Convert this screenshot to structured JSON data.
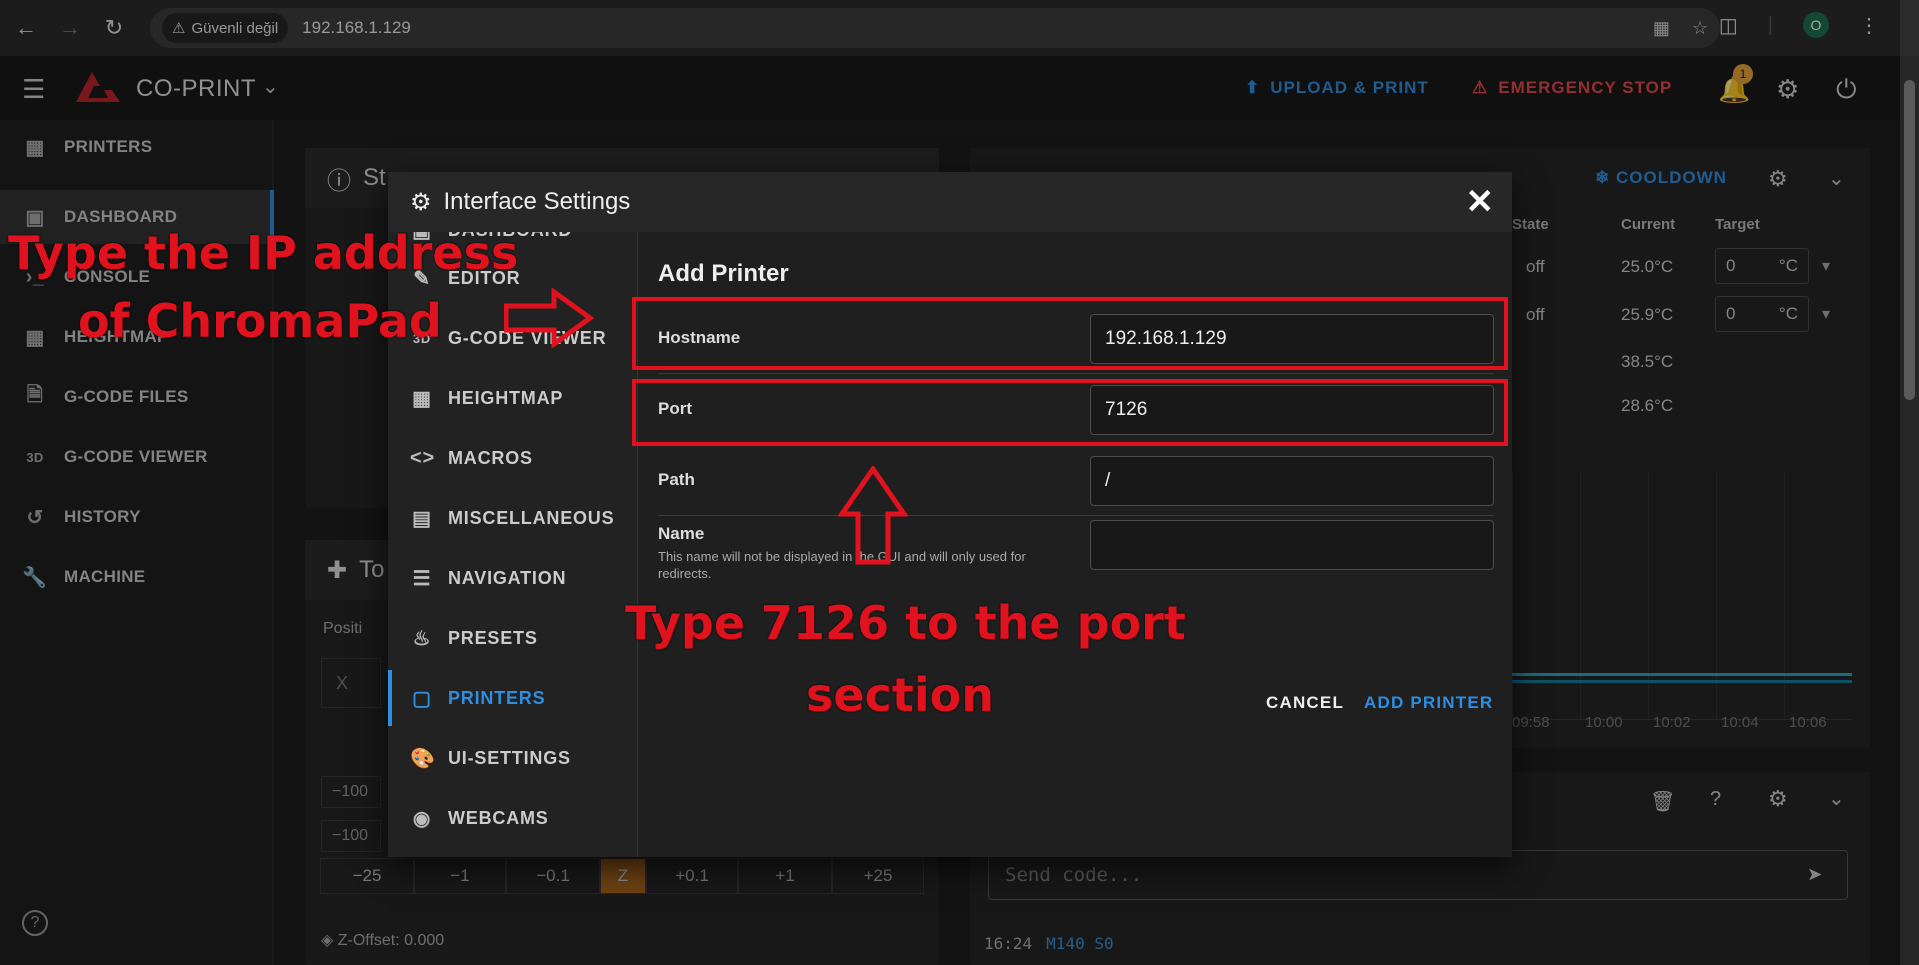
{
  "browser": {
    "security_label": "Güvenli değil",
    "url": "192.168.1.129",
    "profile_initial": "O"
  },
  "app": {
    "brand": "CO-PRINT",
    "upload_label": "UPLOAD & PRINT",
    "estop_label": "EMERGENCY STOP",
    "notification_count": "1",
    "accent_color": "#2e8ee0",
    "danger_color": "#e5484d"
  },
  "sidebar": {
    "items": [
      {
        "label": "PRINTERS",
        "icon": "grid-icon"
      },
      {
        "label": "DASHBOARD",
        "icon": "monitor-icon"
      },
      {
        "label": "CONSOLE",
        "icon": "console-icon"
      },
      {
        "label": "HEIGHTMAP",
        "icon": "heightmap-icon"
      },
      {
        "label": "G-CODE FILES",
        "icon": "file-icon"
      },
      {
        "label": "G-CODE VIEWER",
        "icon": "3d-icon"
      },
      {
        "label": "HISTORY",
        "icon": "history-icon"
      },
      {
        "label": "MACHINE",
        "icon": "wrench-icon"
      }
    ]
  },
  "background": {
    "status_title": "St",
    "toolhead_title": "To",
    "position_label": "Positi",
    "x_label": "X",
    "jog_values": [
      "−25",
      "−1",
      "−0.1",
      "Z",
      "+0.1",
      "+1",
      "+25"
    ],
    "minus100a": "−100",
    "minus100b": "−100",
    "zoffset": "Z-Offset: 0.000",
    "cooldown": "COOLDOWN",
    "temp_headers": {
      "state": "State",
      "current": "Current",
      "target": "Target"
    },
    "temp_rows": [
      {
        "state": "off",
        "current": "25.0°C",
        "target": "0",
        "unit": "°C"
      },
      {
        "state": "off",
        "current": "25.9°C",
        "target": "0",
        "unit": "°C"
      },
      {
        "state": "",
        "current": "38.5°C"
      },
      {
        "state": "",
        "current": "28.6°C"
      }
    ],
    "chart_ticks": [
      "09:58",
      "10:00",
      "10:02",
      "10:04",
      "10:06"
    ],
    "send_placeholder": "Send code...",
    "console_time": "16:24",
    "console_cmd": "M140 S0"
  },
  "modal": {
    "title": "Interface Settings",
    "nav": [
      {
        "label": "DASHBOARD",
        "icon": "monitor-icon"
      },
      {
        "label": "EDITOR",
        "icon": "edit-icon"
      },
      {
        "label": "G-CODE VIEWER",
        "icon": "3d-icon"
      },
      {
        "label": "HEIGHTMAP",
        "icon": "heightmap-icon"
      },
      {
        "label": "MACROS",
        "icon": "code-icon"
      },
      {
        "label": "MISCELLANEOUS",
        "icon": "misc-icon"
      },
      {
        "label": "NAVIGATION",
        "icon": "menu-icon"
      },
      {
        "label": "PRESETS",
        "icon": "fire-icon"
      },
      {
        "label": "PRINTERS",
        "icon": "printer-icon"
      },
      {
        "label": "UI-SETTINGS",
        "icon": "palette-icon"
      },
      {
        "label": "WEBCAMS",
        "icon": "webcam-icon"
      }
    ],
    "section_title": "Add Printer",
    "fields": {
      "hostname": {
        "label": "Hostname",
        "value": "192.168.1.129"
      },
      "port": {
        "label": "Port",
        "value": "7126"
      },
      "path": {
        "label": "Path",
        "value": "/"
      },
      "name": {
        "label": "Name",
        "value": "",
        "description": "This name will not be displayed in the GUI and will only used for redirects."
      }
    },
    "cancel_label": "CANCEL",
    "add_label": "ADD PRINTER"
  },
  "annotations": {
    "ip_line1": "Type the IP  address",
    "ip_line2": "of ChromaPad",
    "port_line1": "Type 7126 to the port",
    "port_line2": "section",
    "color": "#e0121e"
  }
}
